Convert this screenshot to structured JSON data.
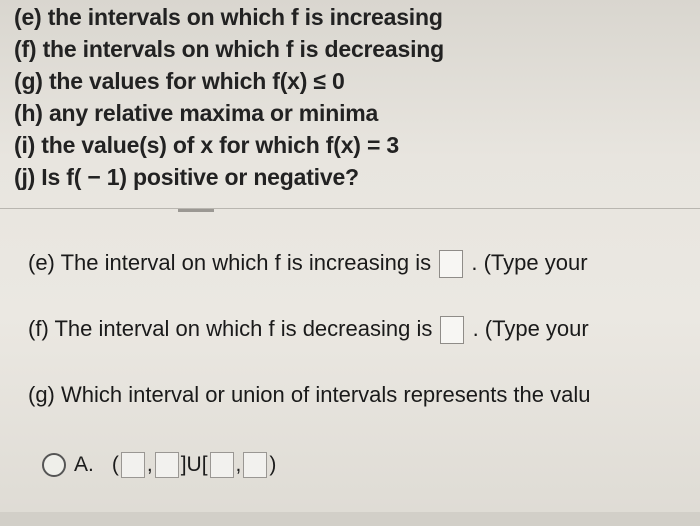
{
  "questions": [
    "(e) the intervals on which f is increasing",
    "(f) the intervals on which f is decreasing",
    "(g) the values for which f(x) ≤ 0",
    "(h) any relative maxima or minima",
    "(i) the value(s) of x for which f(x) = 3",
    "(j) Is f( − 1) positive or negative?"
  ],
  "answers": {
    "e_prefix": "(e) The interval on which f is increasing is",
    "e_suffix": ". (Type your",
    "f_prefix": "(f) The interval on which f is decreasing is",
    "f_suffix": ". (Type your",
    "g_text": "(g) Which interval or union of intervals represents the valu"
  },
  "option_a": {
    "label": "A.",
    "open_paren": "(",
    "comma1": ",",
    "union": "]U[",
    "comma2": ",",
    "close_paren": ")"
  }
}
